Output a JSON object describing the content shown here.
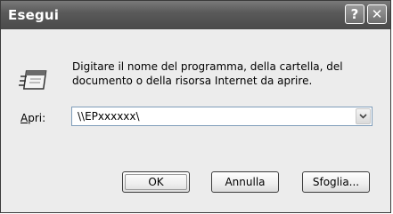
{
  "window": {
    "title": "Esegui",
    "help_glyph": "?",
    "close_glyph": "✕"
  },
  "dialog": {
    "description": "Digitare il nome del programma, della cartella, del documento o della risorsa Internet da aprire.",
    "open_label_underlined": "A",
    "open_label_rest": "pri:",
    "open_value": "\\\\EPxxxxxx\\",
    "ok_label": "OK",
    "cancel_label": "Annulla",
    "browse_label": "Sfoglia..."
  },
  "icons": {
    "run_icon": "run-program-icon",
    "dropdown": "chevron-down-icon"
  },
  "colors": {
    "titlebar": "#5a5a5a",
    "dialog_bg": "#ececec",
    "input_border": "#7f9db9"
  }
}
